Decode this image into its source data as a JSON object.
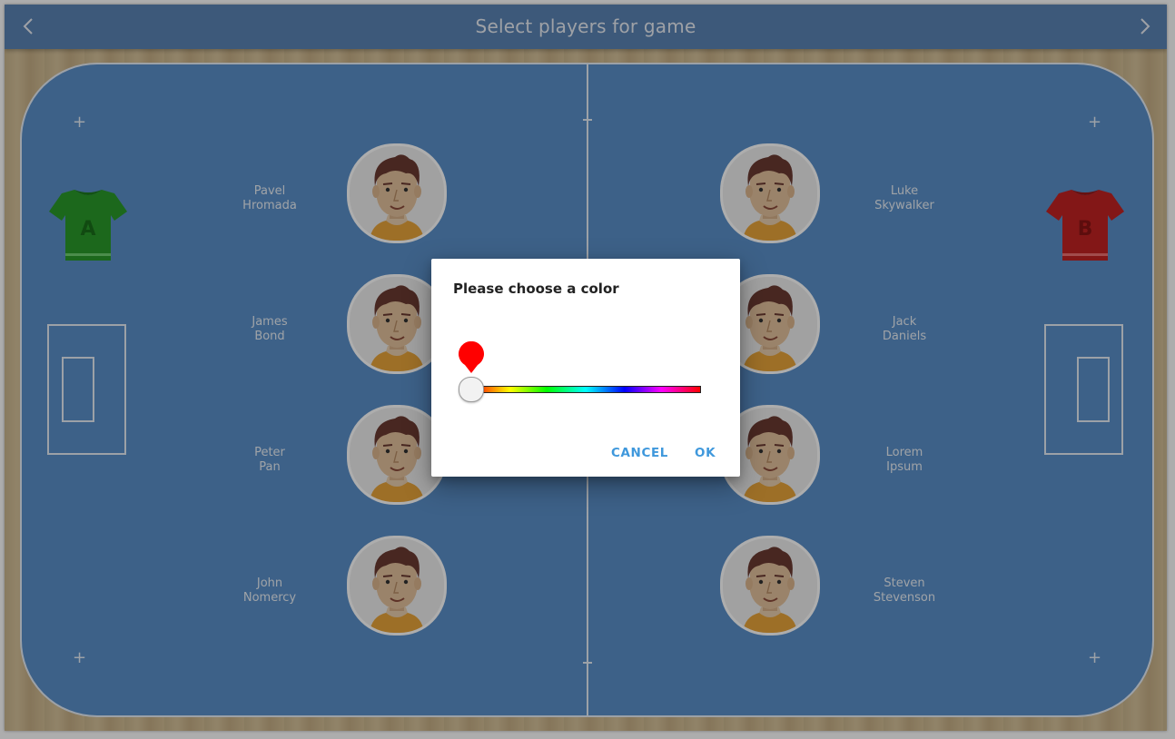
{
  "header": {
    "title": "Select players for game",
    "back_icon": "chevron-left-icon",
    "forward_icon": "chevron-right-icon"
  },
  "teams": {
    "a": {
      "jersey_label": "A",
      "jersey_color": "#2a9a2a",
      "players": [
        {
          "first": "Pavel",
          "last": "Hromada"
        },
        {
          "first": "James",
          "last": "Bond"
        },
        {
          "first": "Peter",
          "last": "Pan"
        },
        {
          "first": "John",
          "last": "Nomercy"
        }
      ]
    },
    "b": {
      "jersey_label": "B",
      "jersey_color": "#c22323",
      "players": [
        {
          "first": "Luke",
          "last": "Skywalker"
        },
        {
          "first": "Jack",
          "last": "Daniels"
        },
        {
          "first": "Lorem",
          "last": "Ipsum"
        },
        {
          "first": "Steven",
          "last": "Stevenson"
        }
      ]
    }
  },
  "court_markers": [
    "+",
    "+",
    "+",
    "+"
  ],
  "dialog": {
    "title": "Please choose a color",
    "selected_color": "#ff0000",
    "hue_position": 0,
    "cancel_label": "CANCEL",
    "ok_label": "OK"
  },
  "colors": {
    "topbar": "#5b83b4",
    "court": "#5b8fc9",
    "accent": "#3f98dc"
  }
}
